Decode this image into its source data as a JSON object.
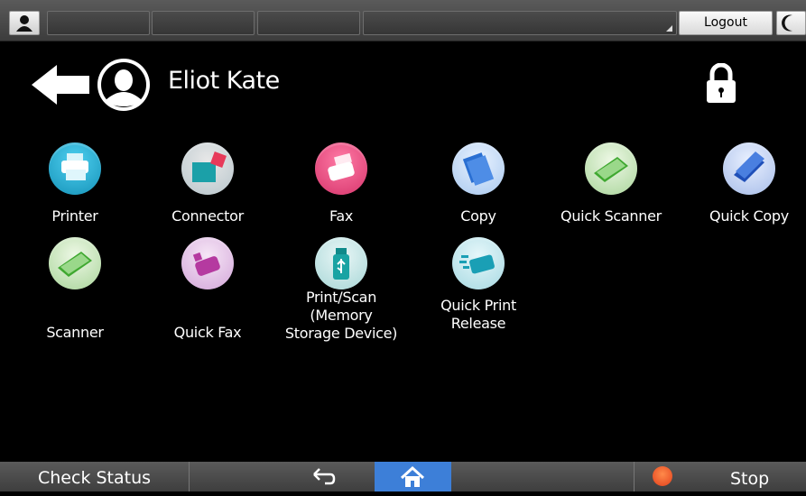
{
  "topbar": {
    "logout_label": "Logout"
  },
  "header": {
    "user_name": "Eliot Kate"
  },
  "apps": [
    {
      "label": "Printer",
      "icon": "printer-icon",
      "color": "#1aa4c9"
    },
    {
      "label": "Connector",
      "icon": "connector-icon",
      "color": "#1a9aa8"
    },
    {
      "label": "Fax",
      "icon": "fax-icon",
      "color": "#e0457b"
    },
    {
      "label": "Copy",
      "icon": "copy-icon",
      "color": "#2a6fd2"
    },
    {
      "label": "Quick Scanner",
      "icon": "scanner-icon",
      "color": "#4bb33a"
    },
    {
      "label": "Quick Copy",
      "icon": "copy-icon",
      "color": "#2a5fc8"
    },
    {
      "label": "Scanner",
      "icon": "scanner-icon",
      "color": "#4bb33a"
    },
    {
      "label": "Quick Fax",
      "icon": "fax-icon",
      "color": "#c43a9a"
    },
    {
      "label": "Print/Scan\n(Memory\nStorage Device)",
      "icon": "usb-icon",
      "color": "#19a3a3"
    },
    {
      "label": "Quick Print\nRelease",
      "icon": "print-release-icon",
      "color": "#1aa4b8"
    }
  ],
  "bottombar": {
    "check_status_label": "Check Status",
    "stop_label": "Stop"
  }
}
